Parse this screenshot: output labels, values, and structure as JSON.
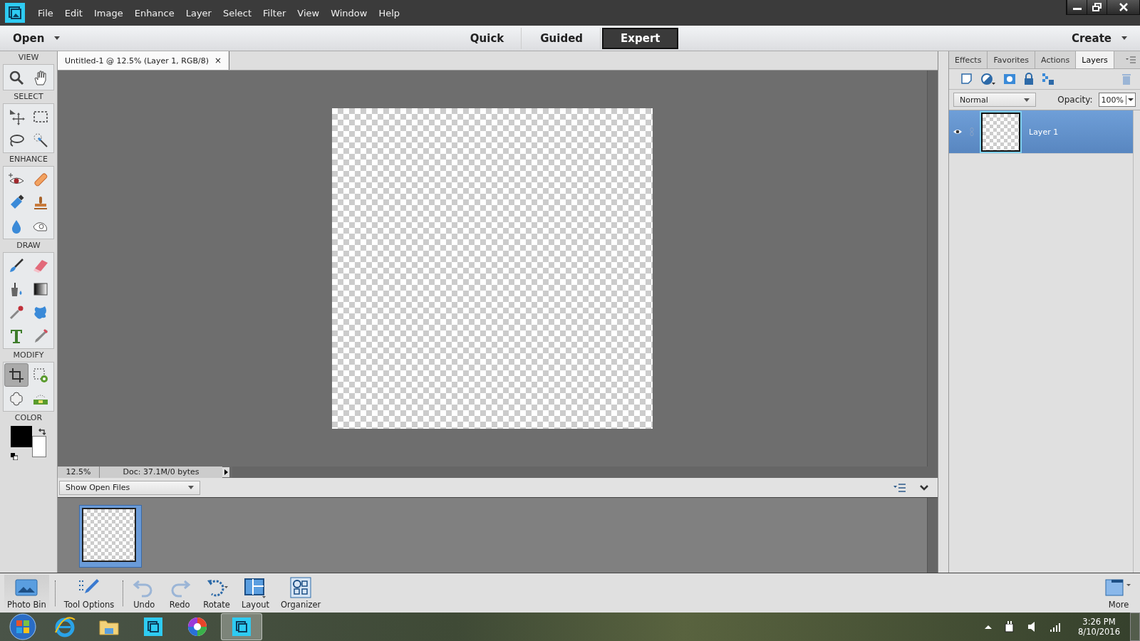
{
  "menu": [
    "File",
    "Edit",
    "Image",
    "Enhance",
    "Layer",
    "Select",
    "Filter",
    "View",
    "Window",
    "Help"
  ],
  "open_button": "Open",
  "modes": [
    {
      "label": "Quick",
      "selected": false
    },
    {
      "label": "Guided",
      "selected": false
    },
    {
      "label": "Expert",
      "selected": true
    }
  ],
  "create_button": "Create",
  "toolbox": [
    {
      "title": "VIEW",
      "tools": [
        {
          "kind": "zoom",
          "selected": false
        },
        {
          "kind": "hand",
          "selected": false
        }
      ]
    },
    {
      "title": "SELECT",
      "tools": [
        {
          "kind": "move",
          "selected": false
        },
        {
          "kind": "marquee",
          "selected": false
        },
        {
          "kind": "lasso",
          "selected": false
        },
        {
          "kind": "wand",
          "selected": false
        }
      ]
    },
    {
      "title": "ENHANCE",
      "tools": [
        {
          "kind": "eye",
          "selected": false
        },
        {
          "kind": "bandage",
          "selected": false
        },
        {
          "kind": "smartbrush",
          "selected": false
        },
        {
          "kind": "stamp",
          "selected": false
        },
        {
          "kind": "drop",
          "selected": false
        },
        {
          "kind": "smudge",
          "selected": false
        }
      ]
    },
    {
      "title": "DRAW",
      "tools": [
        {
          "kind": "brush",
          "selected": false
        },
        {
          "kind": "eraser",
          "selected": false
        },
        {
          "kind": "bucket",
          "selected": false
        },
        {
          "kind": "gradient",
          "selected": false
        },
        {
          "kind": "eyedropper",
          "selected": false
        },
        {
          "kind": "shape",
          "selected": false
        },
        {
          "kind": "type",
          "selected": false
        },
        {
          "kind": "pencil",
          "selected": false
        }
      ]
    },
    {
      "title": "MODIFY",
      "tools": [
        {
          "kind": "crop",
          "selected": true
        },
        {
          "kind": "recompose",
          "selected": false
        },
        {
          "kind": "cookie",
          "selected": false
        },
        {
          "kind": "level",
          "selected": false
        }
      ]
    }
  ],
  "color_section": {
    "title": "COLOR",
    "swatches": [
      {
        "kind": "foreground",
        "color": "#000000"
      },
      {
        "kind": "background",
        "color": "#ffffff"
      }
    ]
  },
  "document_tab": {
    "title": "Untitled-1 @ 12.5% (Layer 1, RGB/8)",
    "close": "×"
  },
  "status_bar": {
    "zoom": "12.5%",
    "doc_info": "Doc: 37.1M/0 bytes"
  },
  "photo_bin": {
    "filter": "Show Open Files",
    "thumbnails": [
      {
        "selected": true
      }
    ]
  },
  "panel_tabs": [
    {
      "label": "Effects",
      "selected": false
    },
    {
      "label": "Favorites",
      "selected": false
    },
    {
      "label": "Actions",
      "selected": false
    },
    {
      "label": "Layers",
      "selected": true
    }
  ],
  "layers_panel": {
    "blend_mode": "Normal",
    "opacity_label": "Opacity:",
    "opacity": "100%",
    "layers": [
      {
        "name": "Layer 1",
        "visible": true,
        "selected": true
      }
    ]
  },
  "bottom_bar": [
    {
      "kind": "photobin",
      "label": "Photo Bin",
      "selected": true
    },
    {
      "kind": "tooloptions",
      "label": "Tool Options",
      "selected": false
    },
    {
      "kind": "undo",
      "label": "Undo",
      "selected": false
    },
    {
      "kind": "redo",
      "label": "Redo",
      "selected": false
    },
    {
      "kind": "rotate",
      "label": "Rotate",
      "selected": false
    },
    {
      "kind": "layout",
      "label": "Layout",
      "selected": false
    },
    {
      "kind": "organizer",
      "label": "Organizer",
      "selected": false
    }
  ],
  "more_button": "More",
  "taskbar": {
    "apps": [
      {
        "kind": "ie",
        "selected": false
      },
      {
        "kind": "folder",
        "selected": false
      },
      {
        "kind": "pse",
        "selected": false
      },
      {
        "kind": "picasa",
        "selected": false
      },
      {
        "kind": "pse",
        "selected": true
      }
    ],
    "time": "3:26 PM",
    "date": "8/10/2016"
  }
}
